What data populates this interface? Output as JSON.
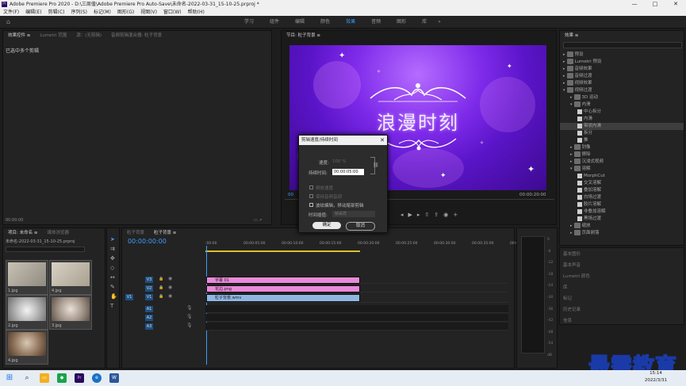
{
  "window": {
    "title": "Adobe Premiere Pro 2020 - D:\\三周值\\Adobe Premiere Pro Auto-Save\\未命名-2022-03-31_15-10-25.prproj *",
    "min": "—",
    "max": "□",
    "close": "✕"
  },
  "menu": [
    "文件(F)",
    "编辑(E)",
    "剪辑(C)",
    "序列(S)",
    "标记(M)",
    "图形(G)",
    "视图(V)",
    "窗口(W)",
    "帮助(H)"
  ],
  "workspaces": {
    "tabs": [
      "学习",
      "组件",
      "编辑",
      "颜色",
      "效果",
      "音频",
      "图形",
      "库"
    ],
    "active": "效果",
    "chevron": "»"
  },
  "source_panel": {
    "tabs": [
      "效果控件 ≡",
      "Lumetri 范围",
      "源：(无剪辑)",
      "音频剪辑混合器: 粒子背景"
    ],
    "message": "已选中多个剪辑",
    "timecode": "00:00:00"
  },
  "program_panel": {
    "tab": "节目: 粒子背景 ≡",
    "overlay_title": "浪漫时刻",
    "timecode_right": "00:00:20:00",
    "timecode_left": "00"
  },
  "effects_panel": {
    "title": "效果 ≡",
    "items": [
      {
        "label": "预设",
        "type": "folder",
        "depth": 0,
        "open": false
      },
      {
        "label": "Lumetri 预设",
        "type": "folder",
        "depth": 0,
        "open": false
      },
      {
        "label": "音频效果",
        "type": "folder",
        "depth": 0,
        "open": false
      },
      {
        "label": "音频过渡",
        "type": "folder",
        "depth": 0,
        "open": false
      },
      {
        "label": "视频效果",
        "type": "folder",
        "depth": 0,
        "open": false
      },
      {
        "label": "视频过渡",
        "type": "folder",
        "depth": 0,
        "open": true
      },
      {
        "label": "3D 运动",
        "type": "folder",
        "depth": 1,
        "open": false
      },
      {
        "label": "内滑",
        "type": "folder",
        "depth": 1,
        "open": true
      },
      {
        "label": "中心拆分",
        "type": "fx",
        "depth": 2
      },
      {
        "label": "内滑",
        "type": "fx",
        "depth": 2
      },
      {
        "label": "带状内滑",
        "type": "fx",
        "depth": 2,
        "selected": true
      },
      {
        "label": "拆分",
        "type": "fx",
        "depth": 2
      },
      {
        "label": "推",
        "type": "fx",
        "depth": 2
      },
      {
        "label": "划像",
        "type": "folder",
        "depth": 1,
        "open": false
      },
      {
        "label": "擦除",
        "type": "folder",
        "depth": 1,
        "open": false
      },
      {
        "label": "沉浸式视频",
        "type": "folder",
        "depth": 1,
        "open": false
      },
      {
        "label": "溶解",
        "type": "folder",
        "depth": 1,
        "open": true
      },
      {
        "label": "MorphCut",
        "type": "fx",
        "depth": 2
      },
      {
        "label": "交叉溶解",
        "type": "fx",
        "depth": 2
      },
      {
        "label": "叠加溶解",
        "type": "fx",
        "depth": 2
      },
      {
        "label": "白场过渡",
        "type": "fx",
        "depth": 2
      },
      {
        "label": "胶片溶解",
        "type": "fx",
        "depth": 2
      },
      {
        "label": "非叠加溶解",
        "type": "fx",
        "depth": 2
      },
      {
        "label": "黑场过渡",
        "type": "fx",
        "depth": 2
      },
      {
        "label": "缩放",
        "type": "folder",
        "depth": 1,
        "open": false
      },
      {
        "label": "页面剥落",
        "type": "folder",
        "depth": 1,
        "open": false
      }
    ],
    "lower_panels": [
      "基本图形",
      "基本声音",
      "Lumetri 颜色",
      "库",
      "标记",
      "历史记录",
      "信息"
    ]
  },
  "project_panel": {
    "tabs": [
      "项目: 未命名 ≡",
      "媒体浏览器"
    ],
    "path": "未命名-2022-03-31_15-10-25.prproj",
    "thumbs": [
      "1.jpg",
      "4.jpg",
      "2.jpg",
      "3.jpg",
      "4.jpg"
    ]
  },
  "timeline": {
    "tabs": [
      "粒子背景",
      "粒子背景 ≡"
    ],
    "timecode": "00:00:00:00",
    "ruler": [
      ":00:00",
      "00:00:05:00",
      "00:00:10:00",
      "00:00:15:00",
      "00:00:20:00",
      "00:00:25:00",
      "00:00:30:00",
      "00:00:35:00",
      "00:00:40:00"
    ],
    "tracks": [
      "V3",
      "V2",
      "V1",
      "A1",
      "A2",
      "A3"
    ],
    "src": "V1",
    "clips": [
      {
        "track": "V3",
        "label": "字幕 01"
      },
      {
        "track": "V2",
        "label": "花边.png"
      },
      {
        "track": "V1",
        "label": "粒子背景.wmv"
      }
    ]
  },
  "meter": {
    "labels": [
      "0",
      "-6",
      "-12",
      "-18",
      "-24",
      "-30",
      "-36",
      "-42",
      "-48",
      "-54",
      "dB"
    ]
  },
  "dialog": {
    "title": "剪辑速度/持续时间",
    "close": "✕",
    "speed_label": "速度:",
    "speed_value": "100 %",
    "duration_label": "持续时间:",
    "duration_value": "00:00:05:00",
    "reverse_label": "倒放速度",
    "keep_pitch_label": "保持音频音调",
    "ripple_label": "波纹编辑，移动尾部剪辑",
    "interp_label": "时间插值:",
    "interp_value": "帧采样",
    "ok": "确定",
    "cancel": "取消"
  },
  "taskbar": {
    "time": "15:14",
    "date": "2022/3/31"
  },
  "watermark": "最需教育"
}
